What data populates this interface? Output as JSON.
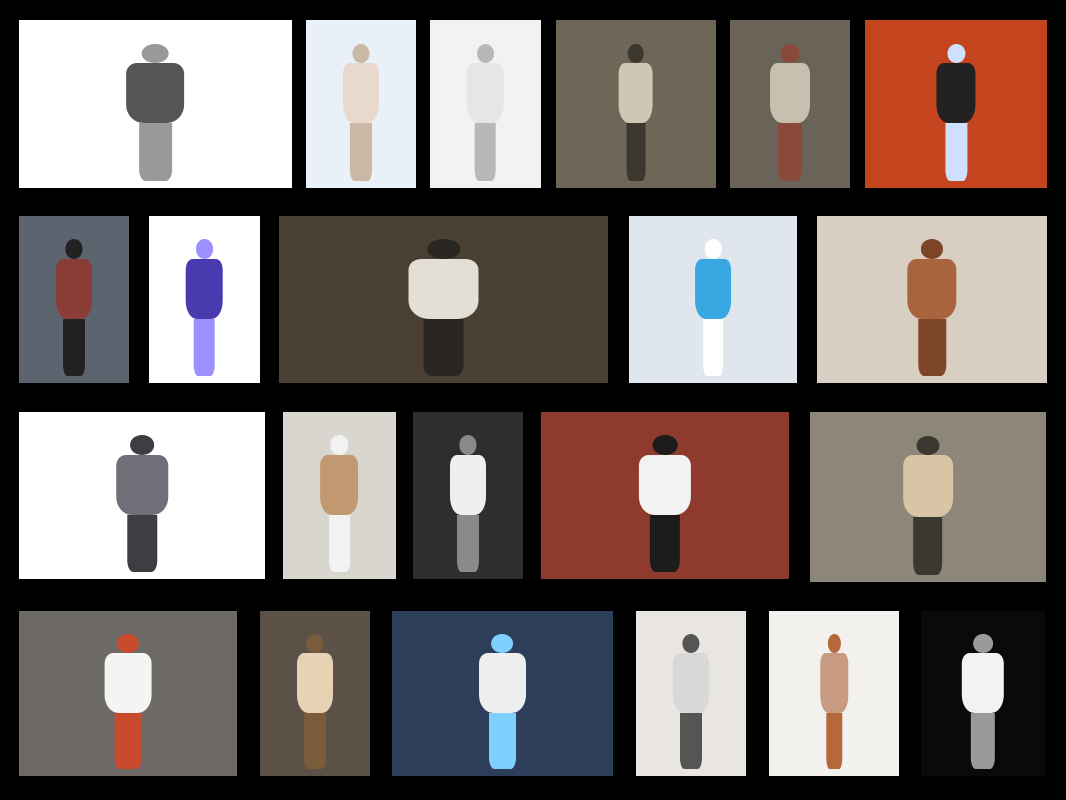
{
  "board": {
    "background": "#000000"
  },
  "photos": [
    {
      "name": "runway-five-looks-photo",
      "bg": "#ffffff",
      "figure": "#555555",
      "accent": "#999999"
    },
    {
      "name": "white-corset-model-photo",
      "bg": "#eaf0f7",
      "figure": "#e8d9cc",
      "accent": "#c9b8a6"
    },
    {
      "name": "white-dress-wired-collar-photo",
      "bg": "#f2f2f2",
      "figure": "#e6e6e6",
      "accent": "#b8b8b8"
    },
    {
      "name": "wired-garment-on-dressform-photo",
      "bg": "#6e6656",
      "figure": "#cfc7b6",
      "accent": "#3c3830"
    },
    {
      "name": "electronics-dress-closeup-photo",
      "bg": "#6a6458",
      "figure": "#c8c0ae",
      "accent": "#8a4a3a"
    },
    {
      "name": "led-arm-wings-photo",
      "bg": "#c4451d",
      "figure": "#222222",
      "accent": "#cfe0ff"
    },
    {
      "name": "spiky-collar-striped-coat-photo",
      "bg": "#5c6470",
      "figure": "#8a3d37",
      "accent": "#222222"
    },
    {
      "name": "blue-metallic-dress-photo",
      "bg": "#ffffff",
      "figure": "#4a3ab0",
      "accent": "#9c90ff"
    },
    {
      "name": "transforming-dress-triptych-photo",
      "bg": "#4a3f33",
      "figure": "#e4dfd6",
      "accent": "#2a2622"
    },
    {
      "name": "glowing-wired-collage-photo",
      "bg": "#dfe6ee",
      "figure": "#39a7e0",
      "accent": "#ffffff"
    },
    {
      "name": "leather-armor-pieces-photo",
      "bg": "#d8cfc2",
      "figure": "#a8643d",
      "accent": "#7c4528"
    },
    {
      "name": "origami-hood-jacket-photo",
      "bg": "#ffffff",
      "figure": "#6f6f78",
      "accent": "#3d3d44"
    },
    {
      "name": "wired-bodice-mannequin-photo",
      "bg": "#d9d6d0",
      "figure": "#c29870",
      "accent": "#f2f2f2"
    },
    {
      "name": "white-ruffled-gown-photo",
      "bg": "#2e2e2e",
      "figure": "#efefef",
      "accent": "#8a8a8a"
    },
    {
      "name": "dress-to-chair-sequence-photo",
      "bg": "#8e3b2e",
      "figure": "#f2f2f2",
      "accent": "#1c1c1c"
    },
    {
      "name": "kinetic-skirt-sculpture-photo",
      "bg": "#8d877a",
      "figure": "#d9c4a5",
      "accent": "#3b3831"
    },
    {
      "name": "circuit-shirt-back-photo",
      "bg": "#6d6a66",
      "figure": "#f4f4f4",
      "accent": "#c94a2c"
    },
    {
      "name": "striped-corset-wires-photo",
      "bg": "#5c5147",
      "figure": "#e7d3b4",
      "accent": "#7a5b3a"
    },
    {
      "name": "white-looks-blue-lights-photo",
      "bg": "#2c3e5a",
      "figure": "#eeeeee",
      "accent": "#7fd0ff"
    },
    {
      "name": "paper-coat-dressform-photo",
      "bg": "#e9e6e1",
      "figure": "#d8d8d8",
      "accent": "#555555"
    },
    {
      "name": "copper-shoulder-sculpture-photo",
      "bg": "#f3f1ee",
      "figure": "#c89a82",
      "accent": "#b5693a"
    },
    {
      "name": "white-umbrella-dress-photo",
      "bg": "#0a0a0a",
      "figure": "#f2f2f2",
      "accent": "#9a9a9a"
    }
  ]
}
